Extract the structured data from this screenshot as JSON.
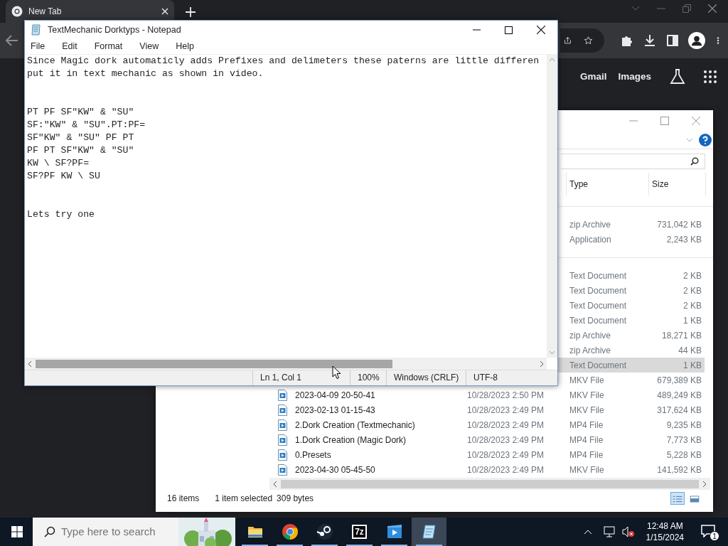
{
  "browser": {
    "tab": {
      "title": "New Tab",
      "selected": true
    },
    "links": [
      "Gmail",
      "Images"
    ]
  },
  "notepad": {
    "title": "TextMechanic Dorktyps - Notepad",
    "menu": [
      "File",
      "Edit",
      "Format",
      "View",
      "Help"
    ],
    "paragraphs": [
      [
        "Since Magic dork automaticly adds Prefixes and delimeters these paterns are little differen",
        "put it in text mechanic as shown in video."
      ],
      [
        "PT PF SF\"KW\" & \"SU\"",
        "SF:\"KW\" & \"SU\".PT:PF=",
        "SF\"KW\" & \"SU\" PF PT",
        "PF PT SF\"KW\" & \"SU\"",
        "KW \\ SF?PF=",
        "SF?PF KW \\ SU"
      ],
      [
        "Lets try one"
      ]
    ],
    "status": [
      "Ln 1, Col 1",
      "100%",
      "Windows (CRLF)",
      "UTF-8"
    ]
  },
  "explorer": {
    "columns": [
      "Type",
      "Size"
    ],
    "groups": [
      {
        "rows": [
          {
            "type": "zip Archive",
            "size": "731,042 KB",
            "selected": false
          },
          {
            "type": "Application",
            "size": "2,243 KB",
            "selected": false
          }
        ]
      },
      {
        "rows": [
          {
            "type": "Text Document",
            "size": "2 KB",
            "selected": false
          },
          {
            "type": "Text Document",
            "size": "2 KB",
            "selected": false
          },
          {
            "type": "Text Document",
            "size": "2 KB",
            "selected": false
          },
          {
            "type": "Text Document",
            "size": "1 KB",
            "selected": false
          },
          {
            "type": "zip Archive",
            "size": "18,271 KB",
            "selected": false
          },
          {
            "type": "zip Archive",
            "size": "44 KB",
            "selected": false
          },
          {
            "type": "Text Document",
            "size": "1 KB",
            "selected": true
          },
          {
            "type": "MKV File",
            "size": "679,389 KB",
            "selected": false
          },
          {
            "name": "2023-04-09 20-50-41",
            "date": "10/28/2023 2:50 PM",
            "type": "MKV File",
            "size": "489,249 KB",
            "selected": false
          },
          {
            "name": "2023-02-13 01-15-43",
            "date": "10/28/2023 2:49 PM",
            "type": "MKV File",
            "size": "317,624 KB",
            "selected": false
          },
          {
            "name": "2.Dork Creation (Textmechanic)",
            "date": "10/28/2023 2:49 PM",
            "type": "MP4 File",
            "size": "9,235 KB",
            "selected": false
          },
          {
            "name": "1.Dork Creation (Magic Dork)",
            "date": "10/28/2023 2:49 PM",
            "type": "MP4 File",
            "size": "7,773 KB",
            "selected": false
          },
          {
            "name": "0.Presets",
            "date": "10/28/2023 2:49 PM",
            "type": "MP4 File",
            "size": "5,228 KB",
            "selected": false
          },
          {
            "name": "2023-04-30 05-45-50",
            "date": "10/28/2023 2:49 PM",
            "type": "MKV File",
            "size": "141,592 KB",
            "selected": false
          }
        ]
      }
    ],
    "status": [
      "16 items",
      "1 item selected",
      "309 bytes"
    ],
    "views": [
      {
        "kind": "details",
        "selected": true
      },
      {
        "kind": "tiles",
        "selected": false
      }
    ]
  },
  "taskbar": {
    "search": {
      "placeholder": "Type here to search"
    },
    "apps": [
      {
        "kind": "folder",
        "active": false
      },
      {
        "kind": "chrome",
        "active": false
      },
      {
        "kind": "steam",
        "active": false
      },
      {
        "kind": "sevenzip",
        "label": "7z",
        "active": false
      },
      {
        "kind": "media",
        "active": false
      },
      {
        "kind": "notepad",
        "active": true
      }
    ],
    "time": "12:48 AM",
    "date": "1/15/2024",
    "notifications": "1"
  }
}
